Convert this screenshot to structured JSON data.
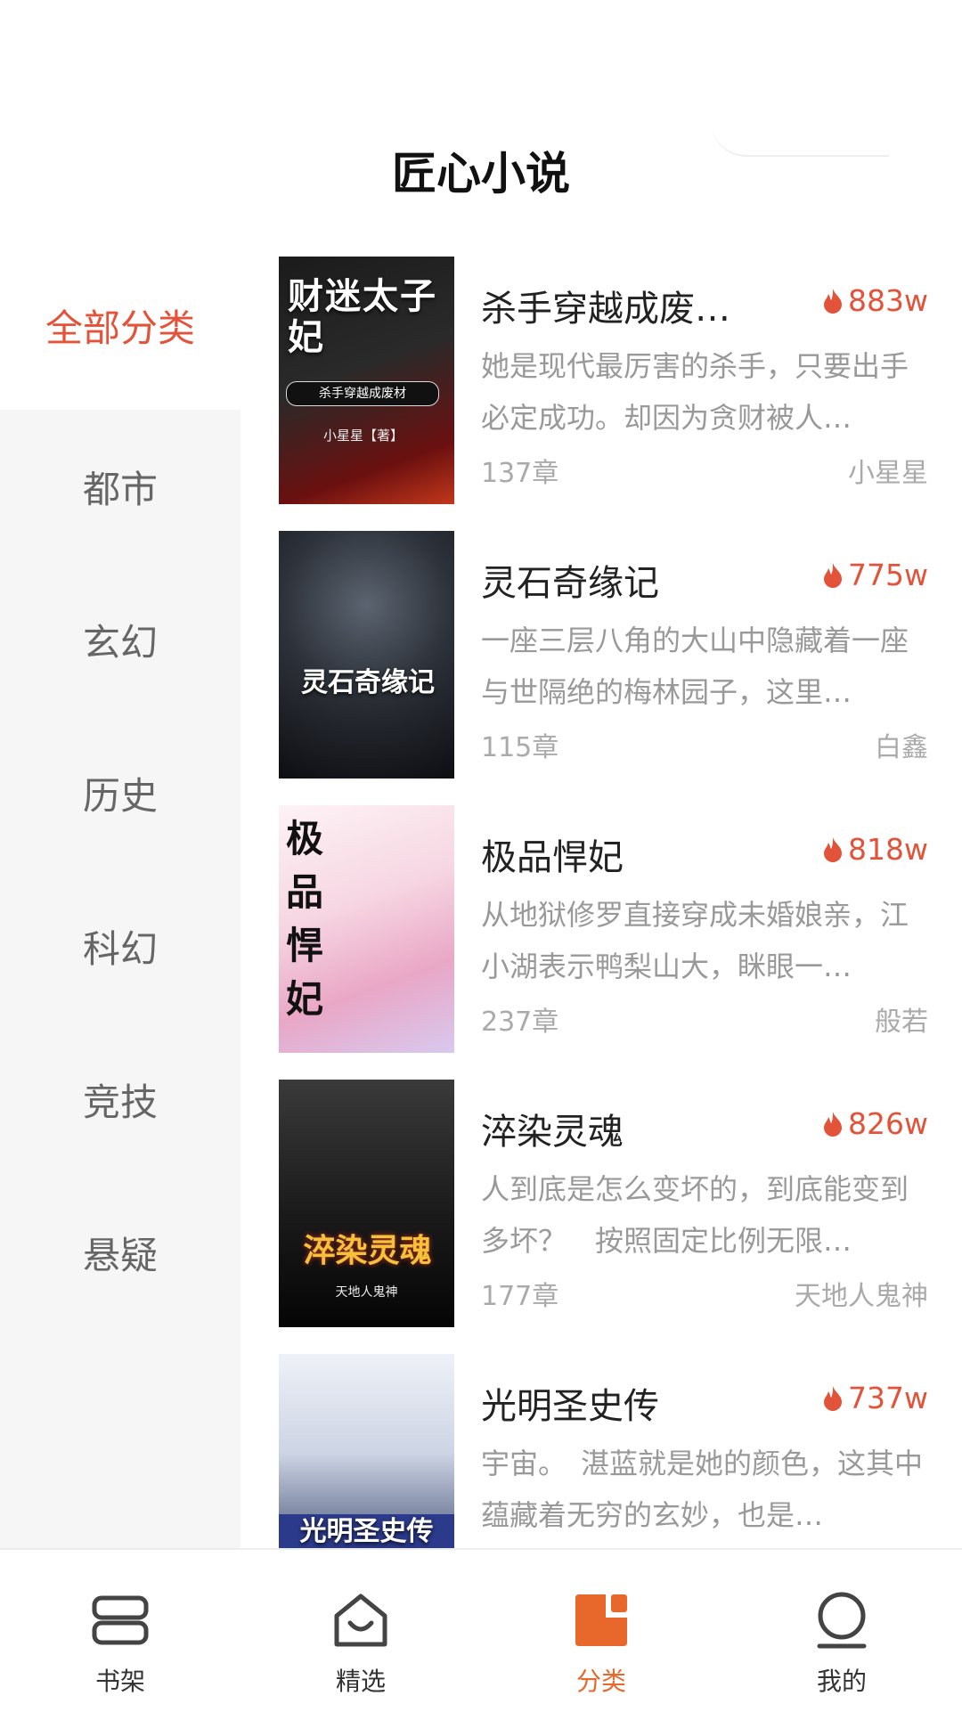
{
  "app_title": "匠心小说",
  "colors": {
    "accent": "#e2533a",
    "tab_active": "#e8672a",
    "sidebar_bg": "#f6f6f6"
  },
  "sidebar": {
    "items": [
      {
        "label": "全部分类",
        "active": true
      },
      {
        "label": "都市",
        "active": false
      },
      {
        "label": "玄幻",
        "active": false
      },
      {
        "label": "历史",
        "active": false
      },
      {
        "label": "科幻",
        "active": false
      },
      {
        "label": "竞技",
        "active": false
      },
      {
        "label": "悬疑",
        "active": false
      }
    ]
  },
  "books": [
    {
      "name": "杀手穿越成废…",
      "heat": "883w",
      "desc": "她是现代最厉害的杀手，只要出手必定成功。却因为贪财被人…",
      "chapters": "137章",
      "author": "小星星",
      "cover_title": "财迷太子妃",
      "cover_sub": "杀手穿越成废材",
      "cover_author": "小星星【著】"
    },
    {
      "name": "灵石奇缘记",
      "heat": "775w",
      "desc": "一座三层八角的大山中隐藏着一座与世隔绝的梅林园子，这里…",
      "chapters": "115章",
      "author": "白鑫",
      "cover_title": "灵石奇缘记"
    },
    {
      "name": "极品悍妃",
      "heat": "818w",
      "desc": "从地狱修罗直接穿成未婚娘亲，江小湖表示鸭梨山大，眯眼一…",
      "chapters": "237章",
      "author": "般若",
      "cover_title": "极品悍妃"
    },
    {
      "name": "淬染灵魂",
      "heat": "826w",
      "desc": "人到底是怎么变坏的，到底能变到多坏？　按照固定比例无限…",
      "chapters": "177章",
      "author": "天地人鬼神",
      "cover_title": "淬染灵魂",
      "cover_author": "天地人鬼神"
    },
    {
      "name": "光明圣史传",
      "heat": "737w",
      "desc": "宇宙。　湛蓝就是她的颜色，这其中蕴藏着无穷的玄妙，也是…",
      "chapters": "",
      "author": "",
      "cover_title": "光明圣史传"
    }
  ],
  "tabbar": {
    "items": [
      {
        "label": "书架",
        "icon": "bookshelf-icon",
        "active": false
      },
      {
        "label": "精选",
        "icon": "featured-home-icon",
        "active": false
      },
      {
        "label": "分类",
        "icon": "category-icon",
        "active": true
      },
      {
        "label": "我的",
        "icon": "profile-icon",
        "active": false
      }
    ]
  }
}
